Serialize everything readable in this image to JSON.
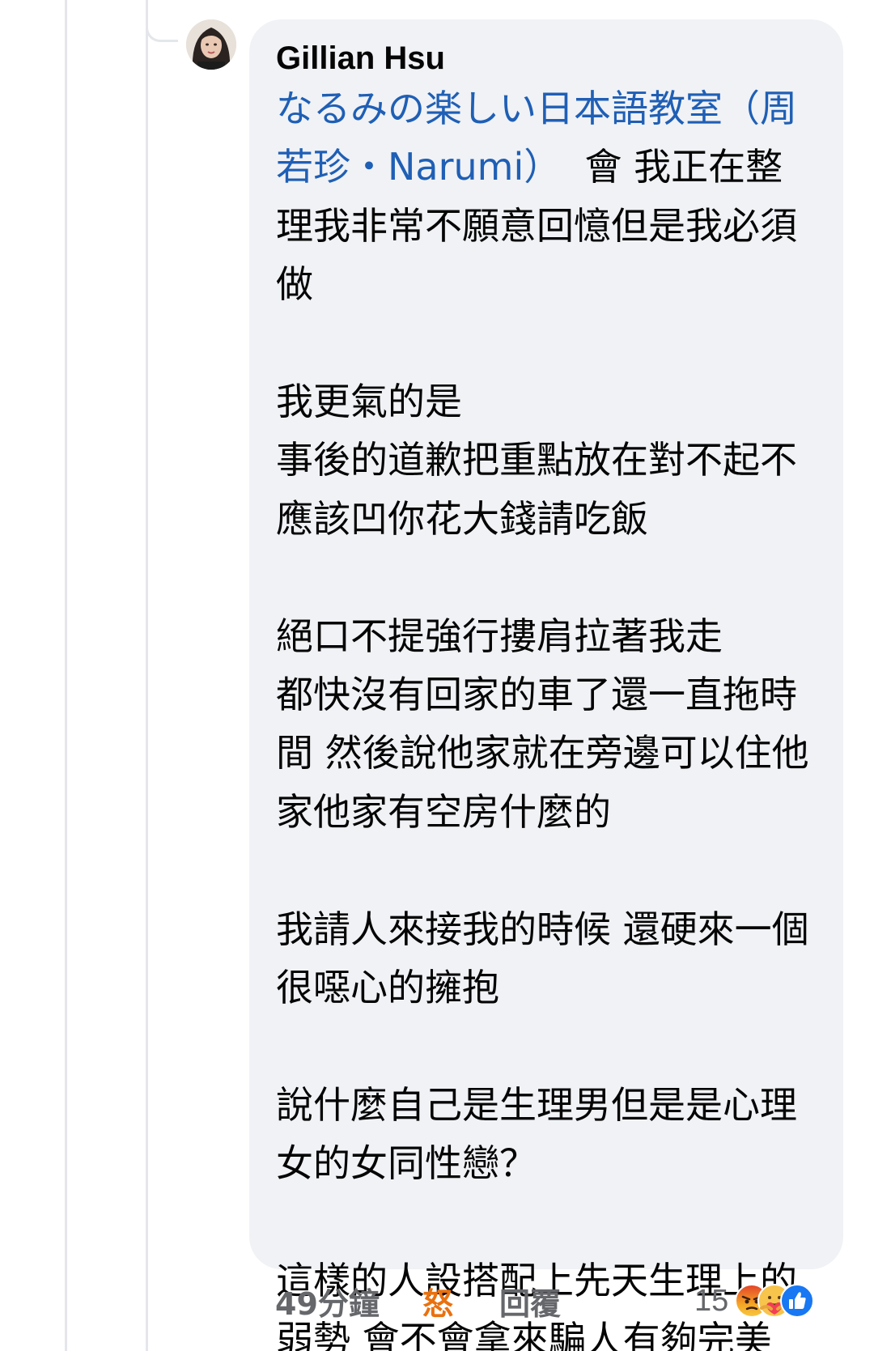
{
  "comment": {
    "author": "Gillian Hsu",
    "mention": "なるみの楽しい日本語教室（周若珍・Narumi）",
    "text": "  會 我正在整理我非常不願意回憶但是我必須做\n\n我更氣的是\n事後的道歉把重點放在對不起不應該凹你花大錢請吃飯\n\n絕口不提強行摟肩拉著我走\n都快沒有回家的車了還一直拖時間 然後說他家就在旁邊可以住他家他家有空房什麼的\n\n我請人來接我的時候 還硬來一個很噁心的擁抱\n\n說什麼自己是生理男但是是心理女的女同性戀？\n\n這樣的人設搭配上先天生理上的弱勢 會不會拿來騙人有夠完美"
  },
  "actions": {
    "time": "49分鐘",
    "reaction_label": "怒",
    "reply": "回覆"
  },
  "reactions": {
    "count": "15",
    "icons": [
      "angry-icon",
      "care-icon",
      "like-icon"
    ]
  },
  "colors": {
    "bubble": "#f0f2f5",
    "mention": "#1f5fb5",
    "angry_label": "#e9710f",
    "meta": "#65676b",
    "thread_line": "#e4e6eb"
  }
}
